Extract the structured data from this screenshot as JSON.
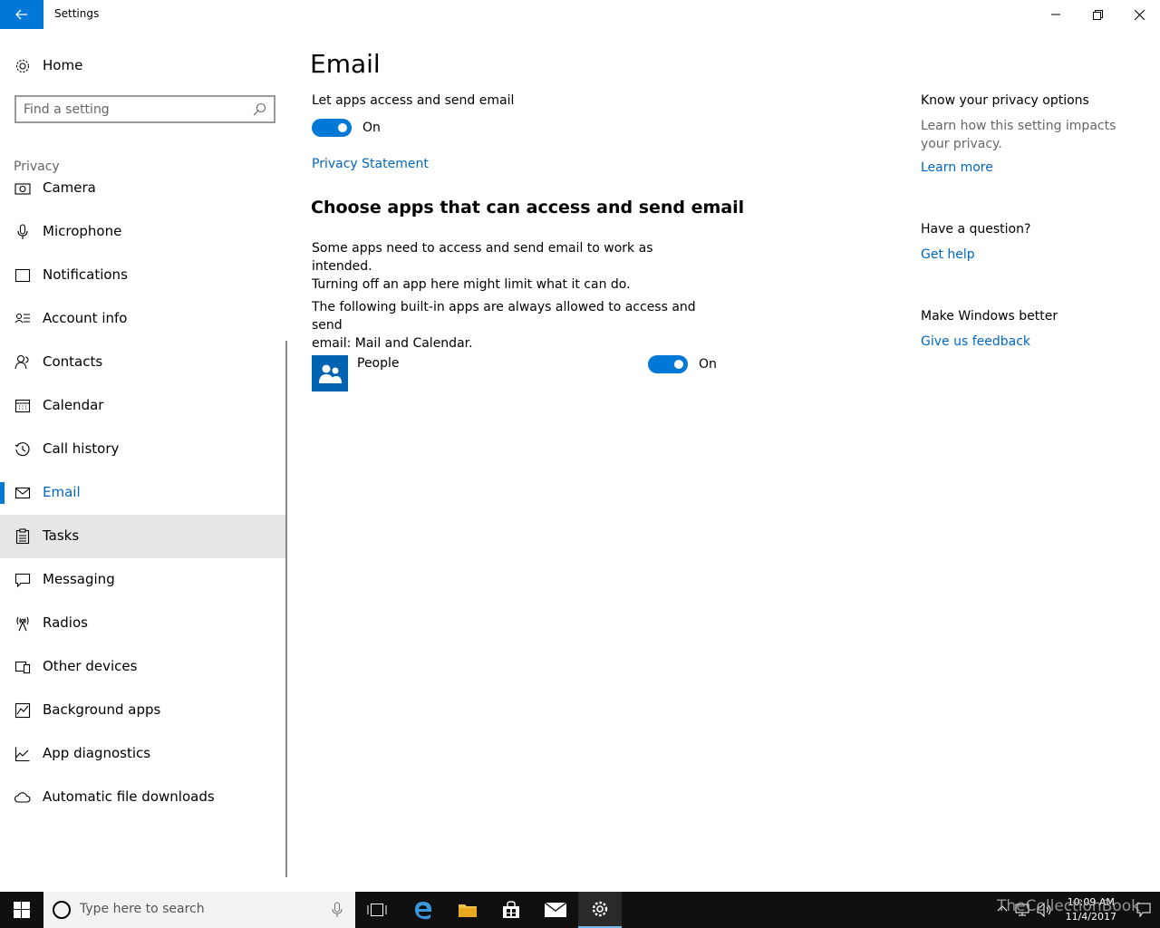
{
  "window": {
    "title": "Settings"
  },
  "sidebar": {
    "home_label": "Home",
    "search_placeholder": "Find a setting",
    "section_label": "Privacy",
    "items": [
      {
        "label": "Camera"
      },
      {
        "label": "Microphone"
      },
      {
        "label": "Notifications"
      },
      {
        "label": "Account info"
      },
      {
        "label": "Contacts"
      },
      {
        "label": "Calendar"
      },
      {
        "label": "Call history"
      },
      {
        "label": "Email"
      },
      {
        "label": "Tasks"
      },
      {
        "label": "Messaging"
      },
      {
        "label": "Radios"
      },
      {
        "label": "Other devices"
      },
      {
        "label": "Background apps"
      },
      {
        "label": "App diagnostics"
      },
      {
        "label": "Automatic file downloads"
      }
    ],
    "selected": "Email"
  },
  "main": {
    "title": "Email",
    "toggle_label": "Let apps access and send email",
    "toggle_state": "On",
    "privacy_link": "Privacy Statement",
    "subheading": "Choose apps that can access and send email",
    "para1_line1": "Some apps need to access and send email to work as intended.",
    "para1_line2": "Turning off an app here might limit what it can do.",
    "para2_line1": "The following built-in apps are always allowed to access and send",
    "para2_line2": "email: Mail and Calendar.",
    "apps": [
      {
        "name": "People",
        "state": "On"
      }
    ]
  },
  "right_panel": {
    "privacy_head": "Know your privacy options",
    "privacy_text": "Learn how this setting impacts your privacy.",
    "learn_more": "Learn more",
    "question_head": "Have a question?",
    "get_help": "Get help",
    "better_head": "Make Windows better",
    "feedback": "Give us feedback"
  },
  "taskbar": {
    "search_placeholder": "Type here to search",
    "time": "10:09 AM",
    "date": "11/4/2017",
    "watermark": "TheCollectionBook"
  },
  "colors": {
    "accent": "#0078d7",
    "link": "#0067c0",
    "taskbar": "#101010"
  }
}
